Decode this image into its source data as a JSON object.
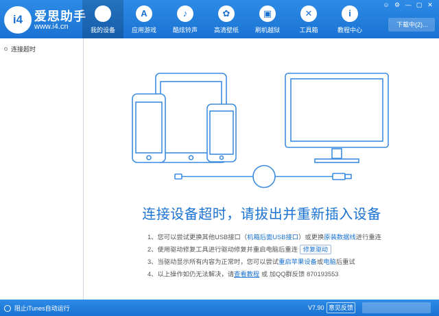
{
  "brand": {
    "name": "爱思助手",
    "url": "www.i4.cn",
    "logo_text": "i4"
  },
  "nav": [
    {
      "label": "我的设备",
      "icon": "apple-icon",
      "glyph": "",
      "active": true
    },
    {
      "label": "应用游戏",
      "icon": "app-store-icon",
      "glyph": "A"
    },
    {
      "label": "酷炫铃声",
      "icon": "bell-icon",
      "glyph": "♪"
    },
    {
      "label": "高清壁纸",
      "icon": "flower-icon",
      "glyph": "✿"
    },
    {
      "label": "刷机越狱",
      "icon": "box-icon",
      "glyph": "▣"
    },
    {
      "label": "工具箱",
      "icon": "wrench-icon",
      "glyph": "✕"
    },
    {
      "label": "教程中心",
      "icon": "info-icon",
      "glyph": "i"
    }
  ],
  "window": {
    "controls": [
      "☺",
      "⚙",
      "—",
      "▢",
      "✕"
    ]
  },
  "download_button": "下载中(2)...",
  "sidebar": {
    "item": "连接超时"
  },
  "main": {
    "headline": "连接设备超时，请拔出并重新插入设备",
    "step1": {
      "a": "1、您可以尝试更换其他USB接口（",
      "b": "机箱后面USB接口",
      "c": "）或更换",
      "d": "原装数据线",
      "e": "进行重连"
    },
    "step2": {
      "a": "2、使用驱动修复工具进行驱动修复并重启电脑后重连",
      "button": "修复驱动"
    },
    "step3": {
      "a": "3、当驱动显示所有内容为正常时，您可以尝试",
      "b": "重启苹果设备",
      "c": "或",
      "d": "电脑",
      "e": "后重试"
    },
    "step4": {
      "a": "4、以上操作如仍无法解决，请",
      "link": "查看教程",
      "c": "或 加QQ群反馈 870193553"
    }
  },
  "status": {
    "itunes": "阻止iTunes自动运行",
    "version": "V7.90",
    "feedback": "意见反馈"
  },
  "colors": {
    "primary": "#1a72d2",
    "illustration": "#3c8ce0"
  }
}
